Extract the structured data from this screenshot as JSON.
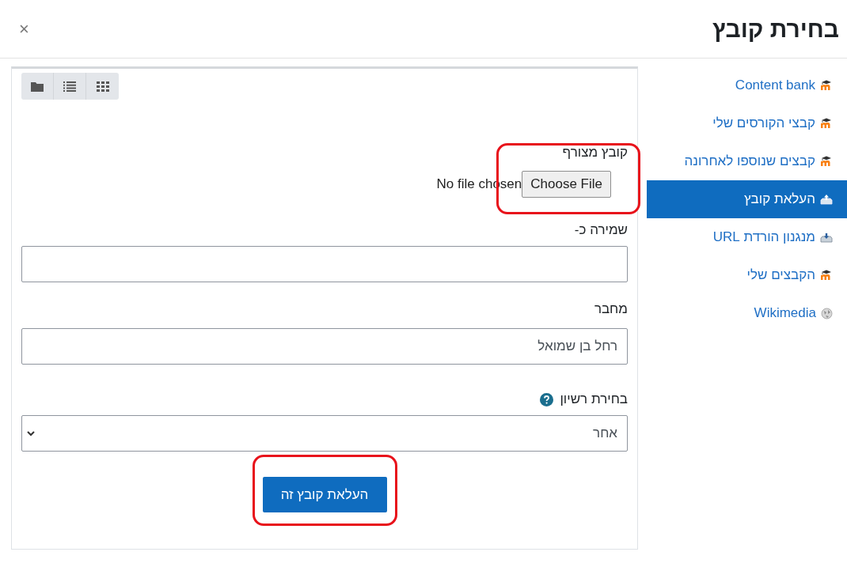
{
  "dialog": {
    "title": "בחירת קובץ",
    "close": "×"
  },
  "sidebar": {
    "items": [
      {
        "label": "Content bank",
        "kind": "moodle",
        "selected": false
      },
      {
        "label": "קבצי הקורסים שלי",
        "kind": "moodle",
        "selected": false
      },
      {
        "label": "קבצים שנוספו לאחרונה",
        "kind": "moodle",
        "selected": false
      },
      {
        "label": "העלאת קובץ",
        "kind": "upload",
        "selected": true
      },
      {
        "label": "מנגנון הורדת URL",
        "kind": "download",
        "selected": false
      },
      {
        "label": "הקבצים שלי",
        "kind": "moodle",
        "selected": false
      },
      {
        "label": "Wikimedia",
        "kind": "globe",
        "selected": false
      }
    ]
  },
  "form": {
    "attachment": {
      "label": "קובץ מצורף",
      "button": "Choose File",
      "status": "No file chosen",
      "highlighted": true
    },
    "save_as": {
      "label": "שמירה כ-"
    },
    "author": {
      "label": "מחבר",
      "value": "רחל בן שמואל"
    },
    "license": {
      "label": "בחירת רשיון",
      "value": "אחר"
    },
    "submit": {
      "label": "העלאת קובץ זה",
      "highlighted": true
    }
  }
}
